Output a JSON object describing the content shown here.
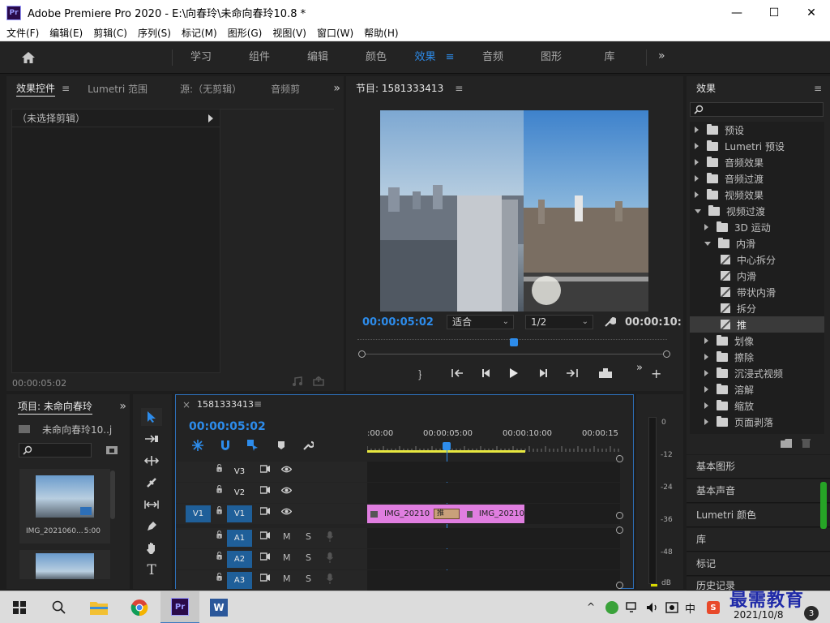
{
  "window": {
    "title": "Adobe Premiere Pro 2020 - E:\\向春玲\\未命向春玲10.8 *",
    "app_icon_text": "Pr",
    "controls": [
      "—",
      "☐",
      "✕"
    ]
  },
  "menu": [
    "文件(F)",
    "编辑(E)",
    "剪辑(C)",
    "序列(S)",
    "标记(M)",
    "图形(G)",
    "视图(V)",
    "窗口(W)",
    "帮助(H)"
  ],
  "workspaces": {
    "tabs": [
      "学习",
      "组件",
      "编辑",
      "颜色",
      "效果",
      "音频",
      "图形",
      "库"
    ],
    "active": "效果",
    "menu_glyph": "≡",
    "more": "»"
  },
  "source_panel": {
    "tabs": [
      "效果控件",
      "Lumetri 范围",
      "源:（无剪辑）",
      "音频剪"
    ],
    "menu_glyph": "≡",
    "more": "»",
    "no_clip": "（未选择剪辑）",
    "timecode": "00:00:05:02"
  },
  "program": {
    "title": "节目: 1581333413",
    "menu_glyph": "≡",
    "timecode": "00:00:05:02",
    "fit": "适合",
    "resolution": "1/2",
    "duration": "00:00:10:",
    "playhead_fraction": 0.5
  },
  "effects": {
    "title": "效果",
    "menu_glyph": "≡",
    "items": [
      {
        "label": "预设",
        "level": 0,
        "icon": "folder-star",
        "expanded": false
      },
      {
        "label": "Lumetri 预设",
        "level": 0,
        "icon": "folder-star",
        "expanded": false
      },
      {
        "label": "音频效果",
        "level": 0,
        "icon": "folder",
        "expanded": false
      },
      {
        "label": "音频过渡",
        "level": 0,
        "icon": "folder",
        "expanded": false
      },
      {
        "label": "视频效果",
        "level": 0,
        "icon": "folder",
        "expanded": false
      },
      {
        "label": "视频过渡",
        "level": 0,
        "icon": "folder",
        "expanded": true
      },
      {
        "label": "3D 运动",
        "level": 1,
        "icon": "folder",
        "expanded": false
      },
      {
        "label": "内滑",
        "level": 1,
        "icon": "folder",
        "expanded": true
      },
      {
        "label": "中心拆分",
        "level": 2,
        "icon": "transition"
      },
      {
        "label": "内滑",
        "level": 2,
        "icon": "transition"
      },
      {
        "label": "带状内滑",
        "level": 2,
        "icon": "transition"
      },
      {
        "label": "拆分",
        "level": 2,
        "icon": "transition"
      },
      {
        "label": "推",
        "level": 2,
        "icon": "transition",
        "selected": true
      },
      {
        "label": "划像",
        "level": 1,
        "icon": "folder",
        "expanded": false
      },
      {
        "label": "擦除",
        "level": 1,
        "icon": "folder",
        "expanded": false
      },
      {
        "label": "沉浸式视频",
        "level": 1,
        "icon": "folder",
        "expanded": false
      },
      {
        "label": "溶解",
        "level": 1,
        "icon": "folder",
        "expanded": false
      },
      {
        "label": "缩放",
        "level": 1,
        "icon": "folder",
        "expanded": false
      },
      {
        "label": "页面剥落",
        "level": 1,
        "icon": "folder",
        "expanded": false
      }
    ]
  },
  "side_panels": [
    "基本图形",
    "基本声音",
    "Lumetri 颜色",
    "库",
    "标记",
    "历史记录"
  ],
  "project": {
    "title": "项目: 未命向春玲",
    "more": "»",
    "file": "未命向春玲10..j",
    "thumb_name": "IMG_2021060...",
    "thumb_duration": "5:00"
  },
  "timeline": {
    "close": "×",
    "sequence": "1581333413",
    "menu_glyph": "≡",
    "timecode": "00:00:05:02",
    "ruler": [
      ":00:00",
      "00:00:05:00",
      "00:00:10:00",
      "00:00:15"
    ],
    "tracks": [
      {
        "name": "V3",
        "kind": "video"
      },
      {
        "name": "V2",
        "kind": "video"
      },
      {
        "name": "V1",
        "kind": "video",
        "source": "V1"
      },
      {
        "name": "A1",
        "kind": "audio"
      },
      {
        "name": "A2",
        "kind": "audio"
      },
      {
        "name": "A3",
        "kind": "audio"
      }
    ],
    "mute": "M",
    "solo": "S",
    "clip_a": "IMG_20210",
    "clip_b": "IMG_20210",
    "transition": "推"
  },
  "meter": {
    "labels": [
      "0",
      "-12",
      "-24",
      "-36",
      "-48",
      "dB"
    ]
  },
  "taskbar": {
    "time": "",
    "date": "2021/10/8",
    "ime": "中",
    "badge": "3"
  },
  "watermark": "最需教育",
  "colors": {
    "accent": "#2d8ceb",
    "clip": "#e07ee0",
    "panel": "#232323"
  }
}
